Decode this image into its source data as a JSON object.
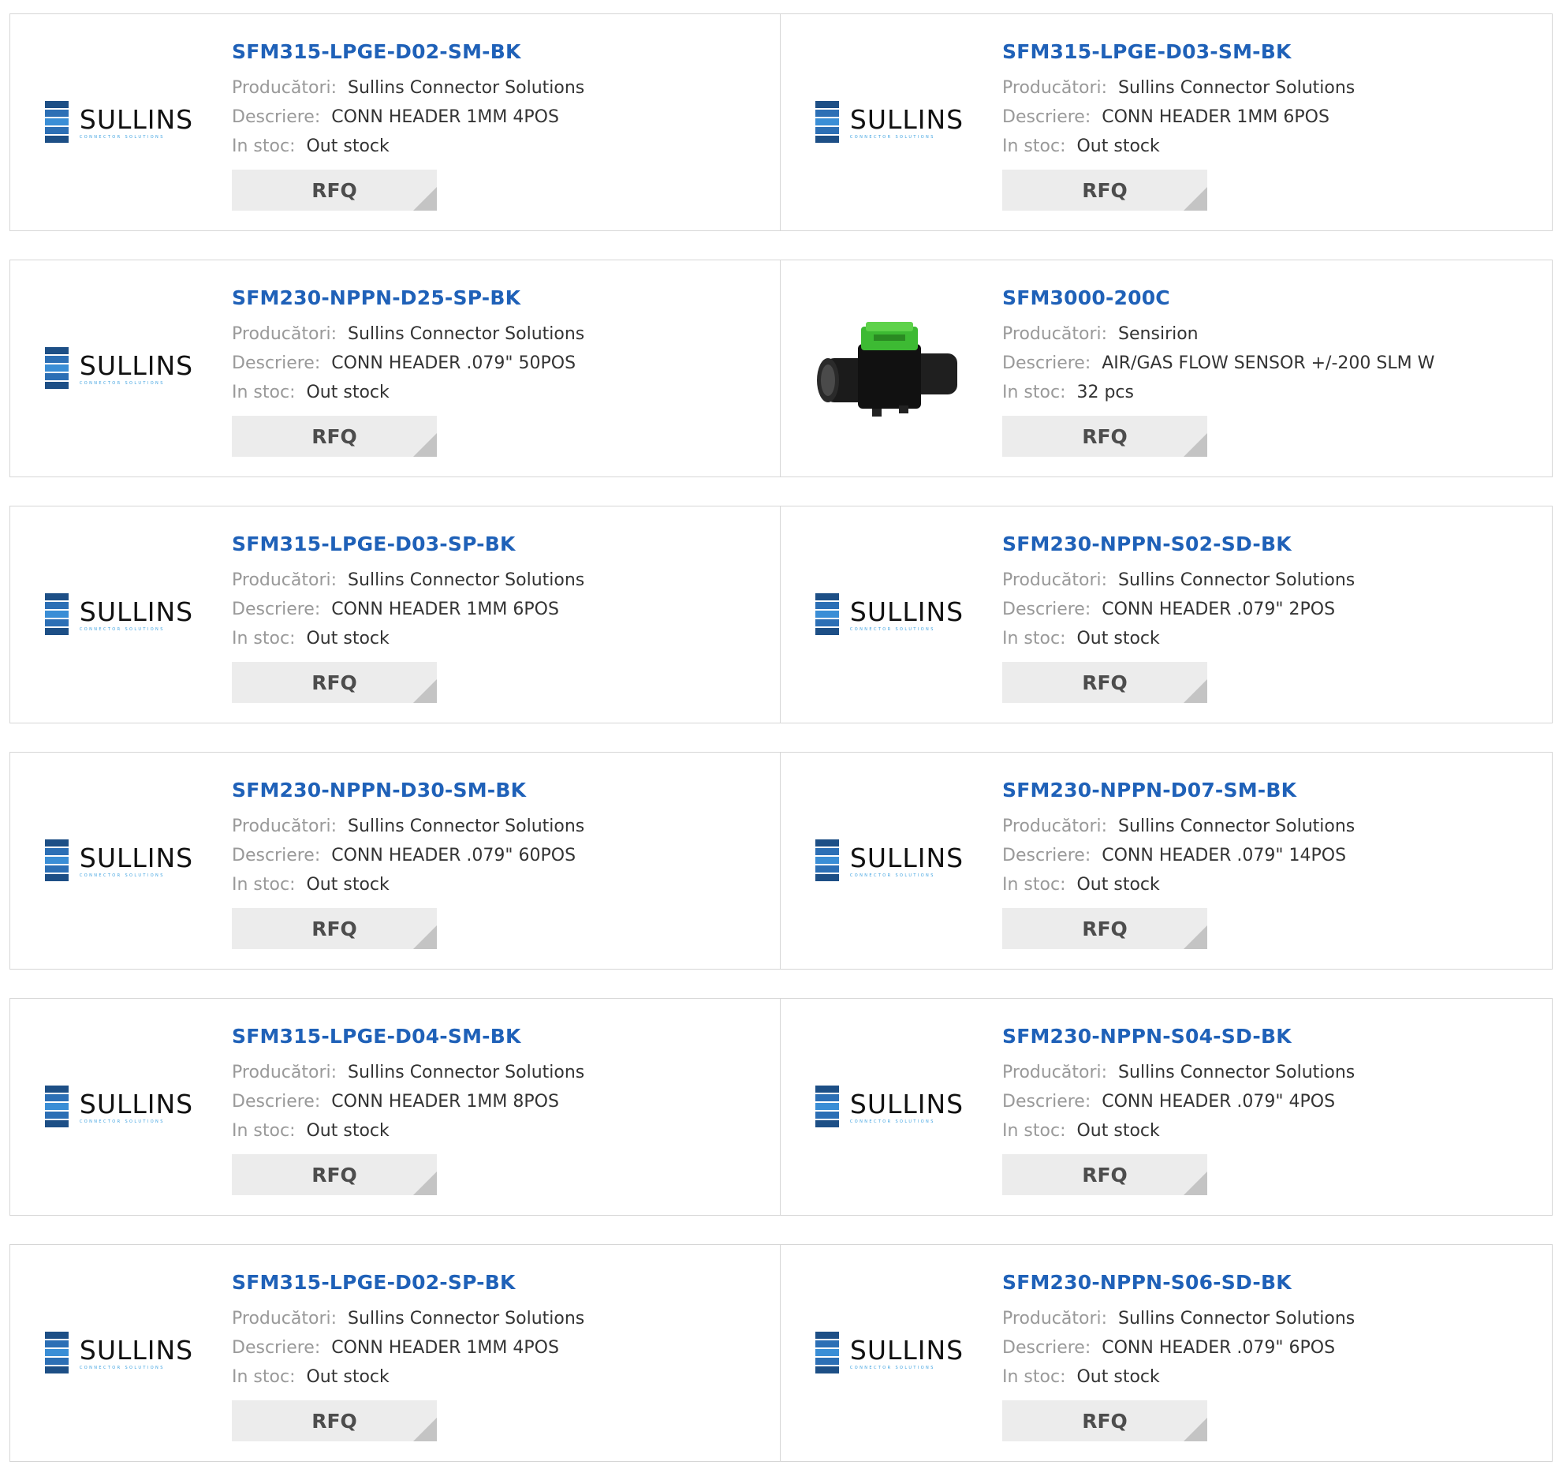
{
  "labels": {
    "manufacturer": "Producători:",
    "description": "Descriere:",
    "stock": "In stoc:",
    "rfq": "RFQ"
  },
  "logo": {
    "word": "SULLINS",
    "sub": "connector solutions"
  },
  "products": [
    {
      "part": "SFM315-LPGE-D02-SM-BK",
      "manufacturer": "Sullins Connector Solutions",
      "description": "CONN HEADER 1MM 4POS",
      "stock": "Out stock",
      "image": "sullins-logo"
    },
    {
      "part": "SFM315-LPGE-D03-SM-BK",
      "manufacturer": "Sullins Connector Solutions",
      "description": "CONN HEADER 1MM 6POS",
      "stock": "Out stock",
      "image": "sullins-logo"
    },
    {
      "part": "SFM230-NPPN-D25-SP-BK",
      "manufacturer": "Sullins Connector Solutions",
      "description": "CONN HEADER .079\" 50POS",
      "stock": "Out stock",
      "image": "sullins-logo"
    },
    {
      "part": "SFM3000-200C",
      "manufacturer": "Sensirion",
      "description": "AIR/GAS FLOW SENSOR +/-200 SLM W",
      "stock": "32 pcs",
      "image": "flow-sensor-photo"
    },
    {
      "part": "SFM315-LPGE-D03-SP-BK",
      "manufacturer": "Sullins Connector Solutions",
      "description": "CONN HEADER 1MM 6POS",
      "stock": "Out stock",
      "image": "sullins-logo"
    },
    {
      "part": "SFM230-NPPN-S02-SD-BK",
      "manufacturer": "Sullins Connector Solutions",
      "description": "CONN HEADER .079\" 2POS",
      "stock": "Out stock",
      "image": "sullins-logo"
    },
    {
      "part": "SFM230-NPPN-D30-SM-BK",
      "manufacturer": "Sullins Connector Solutions",
      "description": "CONN HEADER .079\" 60POS",
      "stock": "Out stock",
      "image": "sullins-logo"
    },
    {
      "part": "SFM230-NPPN-D07-SM-BK",
      "manufacturer": "Sullins Connector Solutions",
      "description": "CONN HEADER .079\" 14POS",
      "stock": "Out stock",
      "image": "sullins-logo"
    },
    {
      "part": "SFM315-LPGE-D04-SM-BK",
      "manufacturer": "Sullins Connector Solutions",
      "description": "CONN HEADER 1MM 8POS",
      "stock": "Out stock",
      "image": "sullins-logo"
    },
    {
      "part": "SFM230-NPPN-S04-SD-BK",
      "manufacturer": "Sullins Connector Solutions",
      "description": "CONN HEADER .079\" 4POS",
      "stock": "Out stock",
      "image": "sullins-logo"
    },
    {
      "part": "SFM315-LPGE-D02-SP-BK",
      "manufacturer": "Sullins Connector Solutions",
      "description": "CONN HEADER 1MM 4POS",
      "stock": "Out stock",
      "image": "sullins-logo"
    },
    {
      "part": "SFM230-NPPN-S06-SD-BK",
      "manufacturer": "Sullins Connector Solutions",
      "description": "CONN HEADER .079\" 6POS",
      "stock": "Out stock",
      "image": "sullins-logo"
    }
  ]
}
